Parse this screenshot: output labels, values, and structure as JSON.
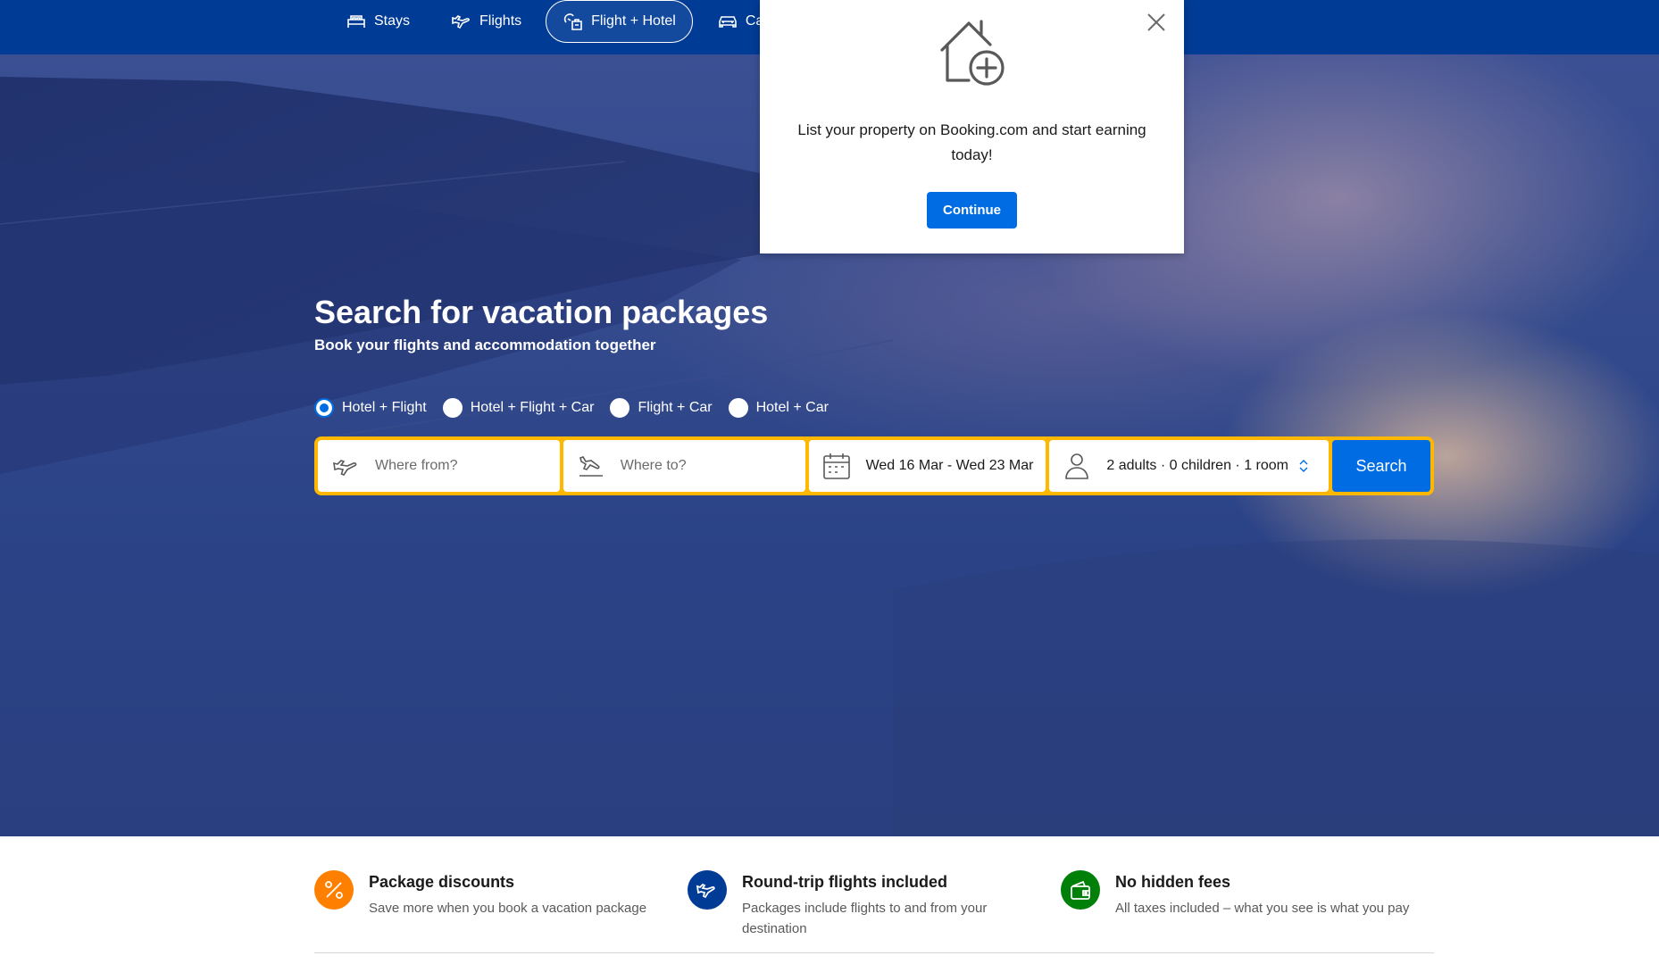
{
  "nav": {
    "items": [
      {
        "label": "Stays",
        "icon": "bed-icon"
      },
      {
        "label": "Flights",
        "icon": "plane-icon"
      },
      {
        "label": "Flight + Hotel",
        "icon": "flight-hotel-icon",
        "active": true
      },
      {
        "label": "Car r",
        "icon": "car-icon"
      }
    ]
  },
  "hero": {
    "title": "Search for vacation packages",
    "subtitle": "Book your flights and accommodation together"
  },
  "package_options": [
    {
      "label": "Hotel + Flight",
      "selected": true
    },
    {
      "label": "Hotel + Flight + Car",
      "selected": false
    },
    {
      "label": "Flight + Car",
      "selected": false
    },
    {
      "label": "Hotel + Car",
      "selected": false
    }
  ],
  "search": {
    "from_placeholder": "Where from?",
    "to_placeholder": "Where to?",
    "dates": "Wed 16 Mar - Wed 23 Mar",
    "guests": "2 adults · 0 children · 1 room",
    "button": "Search"
  },
  "popup": {
    "message": "List your property on Booking.com and start earning today!",
    "button": "Continue"
  },
  "features": [
    {
      "title": "Package discounts",
      "desc": "Save more when you book a vacation package",
      "icon": "percent-icon",
      "color": "#ff8000"
    },
    {
      "title": "Round-trip flights included",
      "desc": "Packages include flights to and from your destination",
      "icon": "plane-icon",
      "color": "#003b95"
    },
    {
      "title": "No hidden fees",
      "desc": "All taxes included – what you see is what you pay",
      "icon": "wallet-icon",
      "color": "#008009"
    }
  ],
  "colors": {
    "brand_blue": "#003b95",
    "action_blue": "#006ce4",
    "search_border": "#ffb700"
  }
}
